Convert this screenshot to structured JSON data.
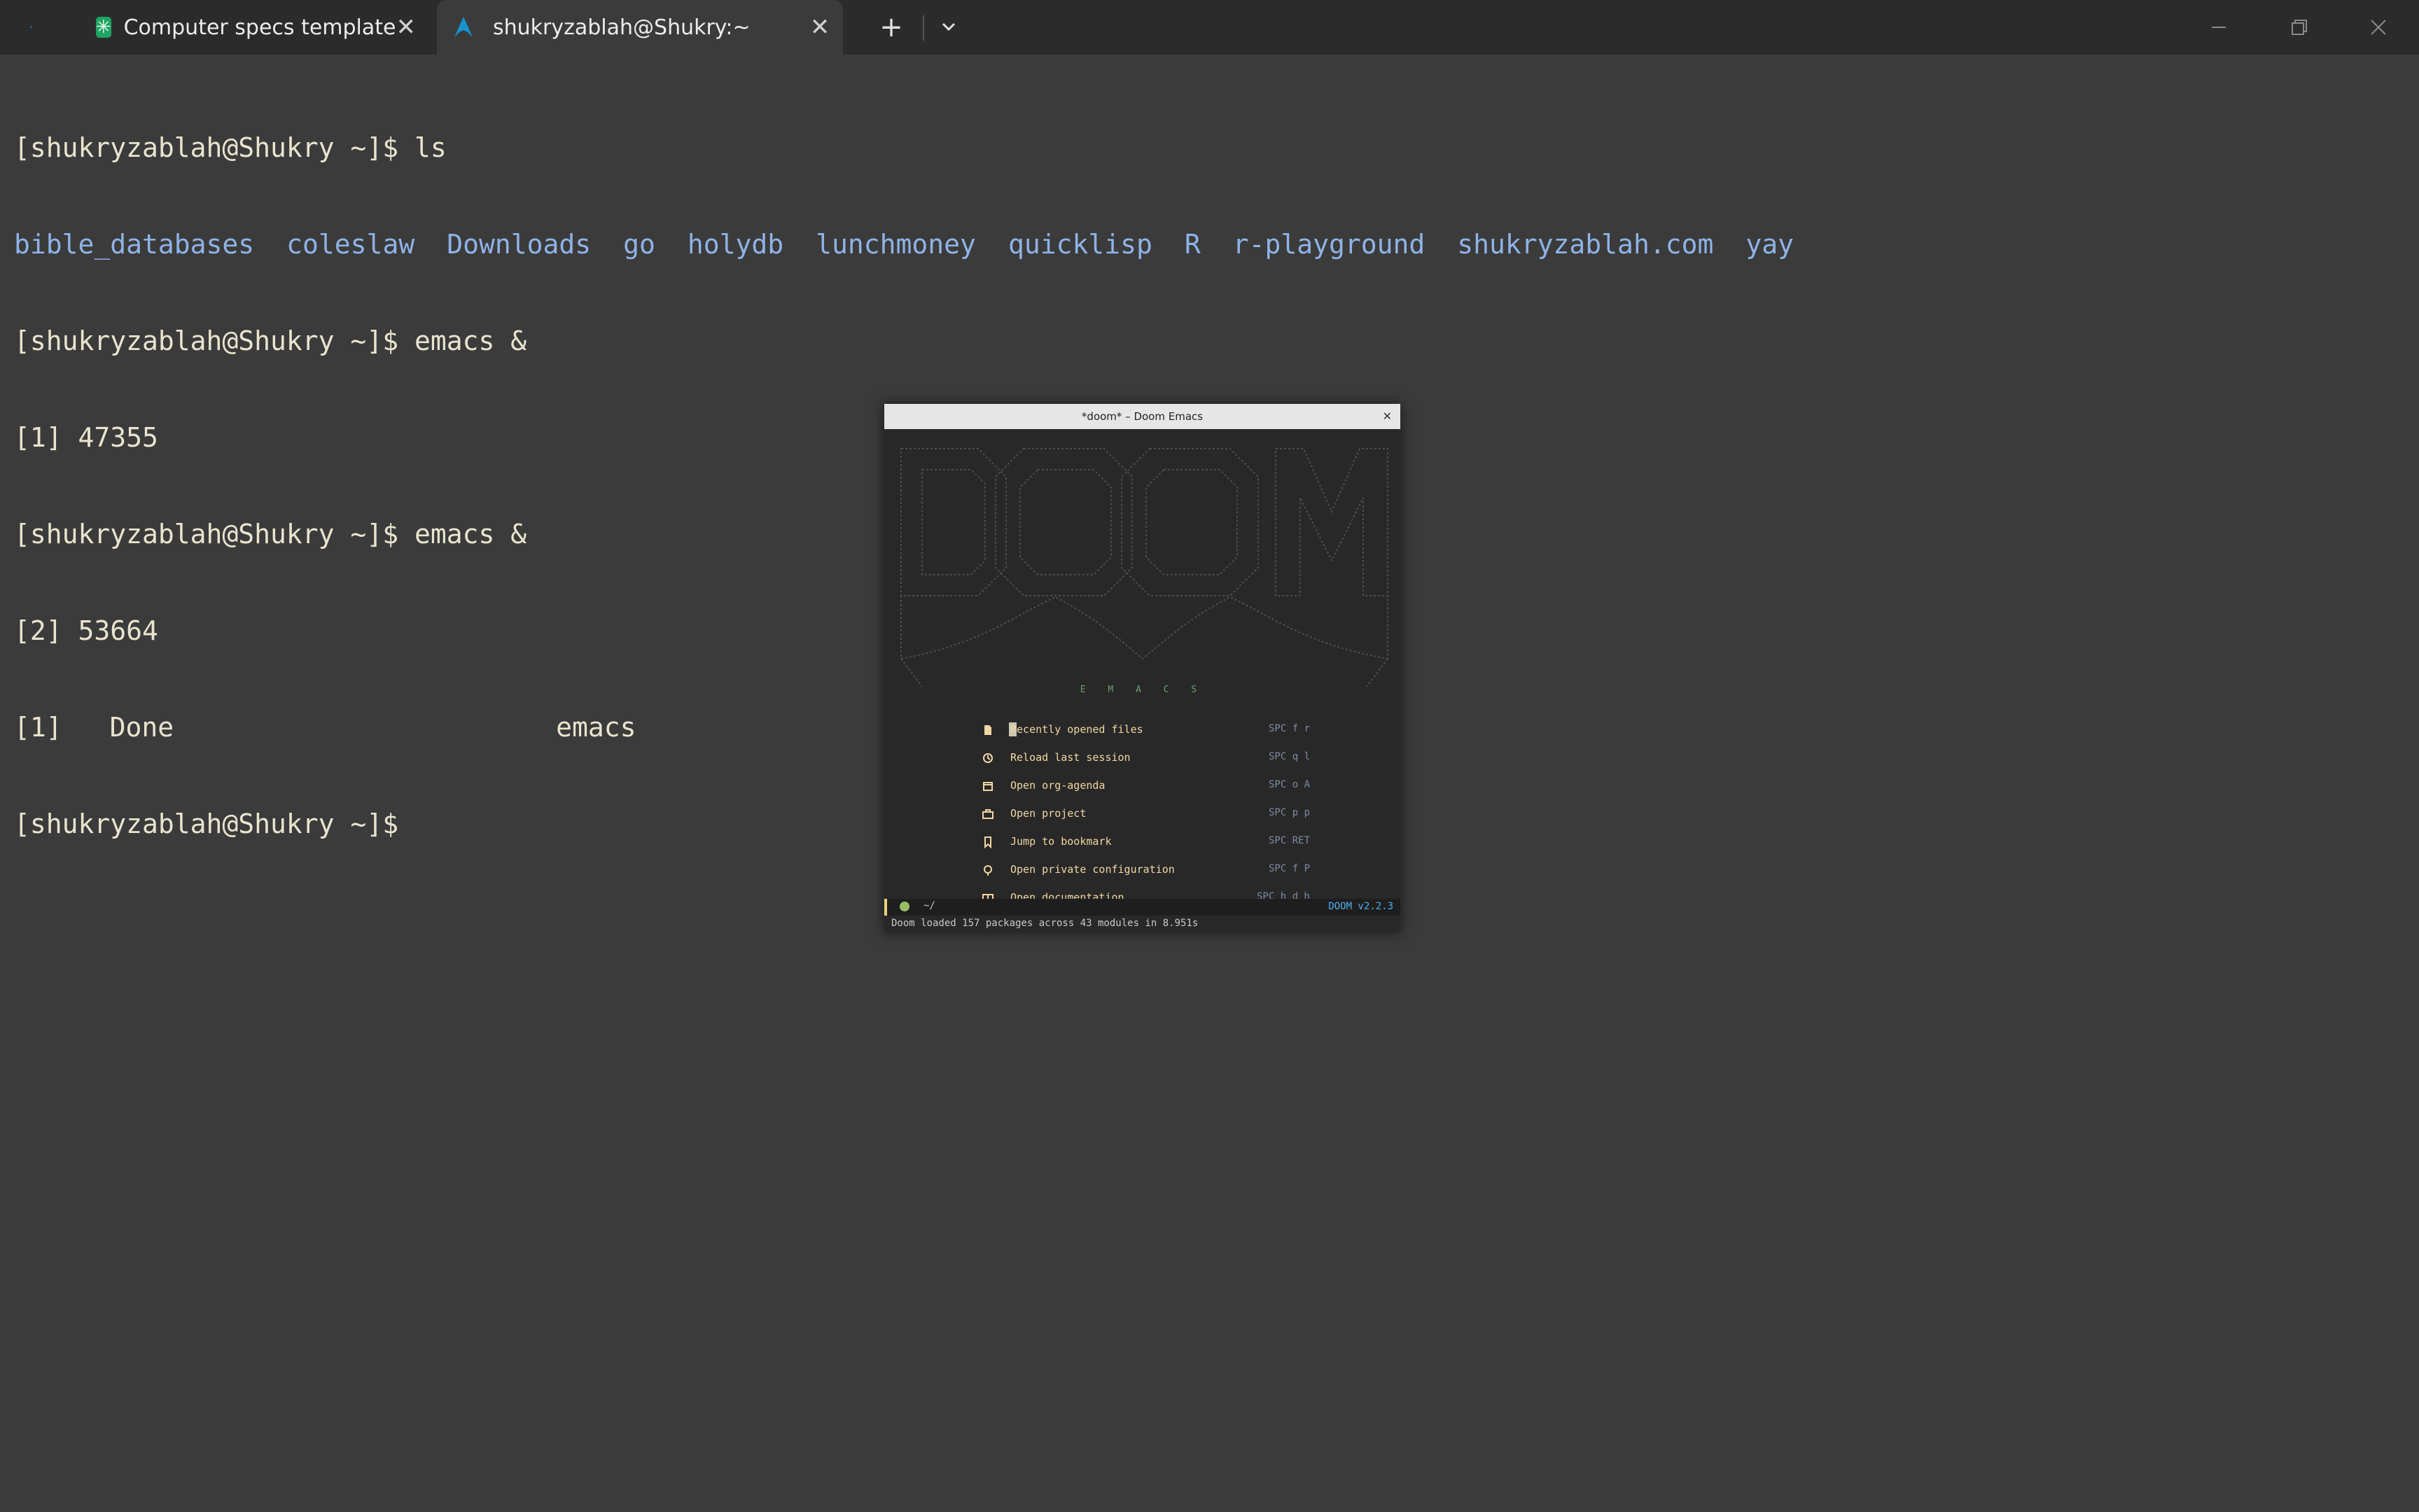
{
  "tabs": [
    {
      "title": "Computer specs template",
      "icon": "google-sheets-icon"
    },
    {
      "title": "shukryzablah@Shukry:~",
      "icon": "arch-linux-icon"
    }
  ],
  "tab_controls": {
    "new_tab": "+"
  },
  "terminal": {
    "prompt": "[shukryzablah@Shukry ~]$",
    "cmd1": " ls",
    "dirs": [
      "bible_databases",
      "coleslaw",
      "Downloads",
      "go",
      "holydb",
      "lunchmoney",
      "quicklisp",
      "R",
      "r-playground",
      "shukryzablah.com",
      "yay"
    ],
    "cmd2": " emacs &",
    "job1": "[1] 47355",
    "cmd3": " emacs &",
    "job2": "[2] 53664",
    "done_id": "[1]",
    "done_status": "Done",
    "done_cmd": "emacs"
  },
  "emacs": {
    "title": "*doom* – Doom Emacs",
    "banner_word": "E M A C S",
    "menu": [
      {
        "label": "Recently opened files",
        "key": "SPC f r",
        "icon": "file-icon"
      },
      {
        "label": "Reload last session",
        "key": "SPC q l",
        "icon": "history-icon"
      },
      {
        "label": "Open org-agenda",
        "key": "SPC o A",
        "icon": "calendar-icon"
      },
      {
        "label": "Open project",
        "key": "SPC p p",
        "icon": "briefcase-icon"
      },
      {
        "label": "Jump to bookmark",
        "key": "SPC RET",
        "icon": "bookmark-icon"
      },
      {
        "label": "Open private configuration",
        "key": "SPC f P",
        "icon": "tools-icon"
      },
      {
        "label": "Open documentation",
        "key": "SPC h d h",
        "icon": "book-icon"
      }
    ],
    "modeline": {
      "path": "~/",
      "version": "DOOM v2.2.3"
    },
    "echo": "Doom loaded 157 packages across 43 modules in 8.951s"
  }
}
